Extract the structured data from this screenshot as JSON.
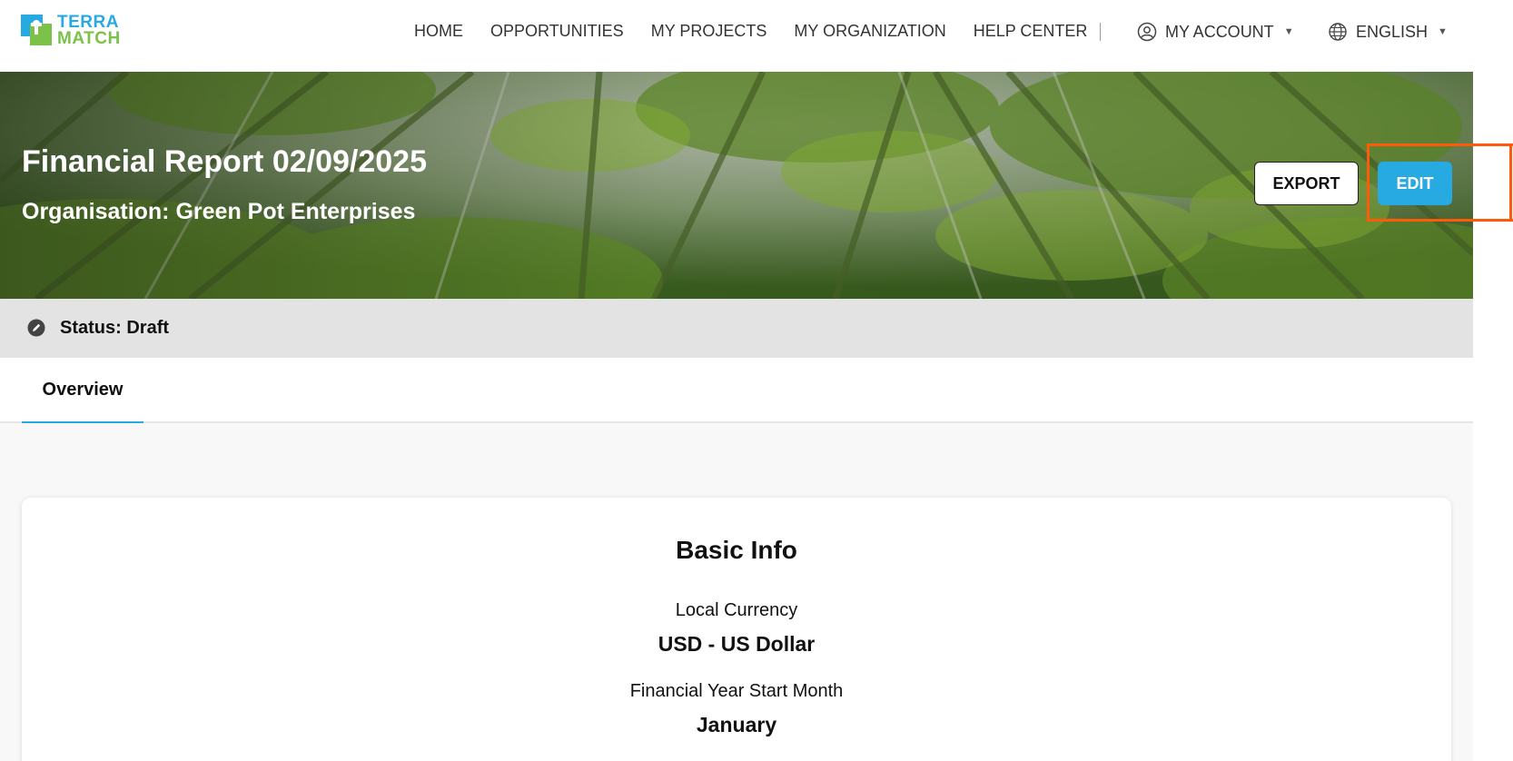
{
  "brand": {
    "logo_line1": "TERRA",
    "logo_line2": "MATCH",
    "color_primary": "#27a9e1",
    "color_secondary": "#7cc24a"
  },
  "nav": {
    "links": [
      "HOME",
      "OPPORTUNITIES",
      "MY PROJECTS",
      "MY ORGANIZATION",
      "HELP CENTER"
    ],
    "account_label": "MY ACCOUNT",
    "account_icon": "user-circle-icon",
    "language_label": "ENGLISH",
    "language_icon": "globe-icon"
  },
  "hero": {
    "title": "Financial Report 02/09/2025",
    "subtitle": "Organisation: Green Pot Enterprises",
    "export_label": "EXPORT",
    "edit_label": "EDIT",
    "highlight_color": "#ff5a0a"
  },
  "status": {
    "icon": "pencil-circle-icon",
    "text": "Status: Draft"
  },
  "tabs": [
    {
      "label": "Overview",
      "active": true
    }
  ],
  "basic_info": {
    "title": "Basic Info",
    "fields": [
      {
        "label": "Local Currency",
        "value": "USD - US Dollar"
      },
      {
        "label": "Financial Year Start Month",
        "value": "January"
      }
    ]
  }
}
